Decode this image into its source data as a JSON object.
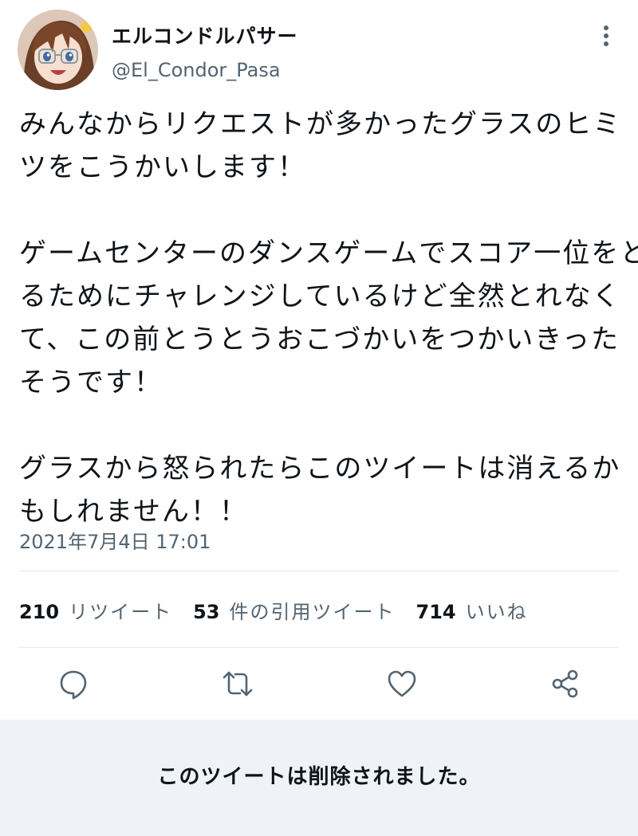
{
  "tweet": {
    "author": {
      "display_name": "エルコンドルパサー",
      "handle": "@El_Condor_Pasa",
      "avatar_icon": "character-avatar"
    },
    "more_icon": "more-vertical-icon",
    "body": [
      [
        "みんなからリクエストが多かったグラスのヒミ",
        "ツをこうかいします！"
      ],
      [
        "ゲームセンターのダンスゲームでスコア一位をと",
        "るためにチャレンジしているけど全然とれなく",
        "て、この前とうとうおこづかいをつかいきった",
        "そうです！"
      ],
      [
        "グラスから怒られたらこのツイートは消えるか",
        "もしれません！！"
      ]
    ],
    "timestamp": "2021年7月4日 17:01",
    "stats": {
      "retweets": {
        "count": "210",
        "label": "リツイート"
      },
      "quotes": {
        "count": "53",
        "label": "件の引用ツイート"
      },
      "likes": {
        "count": "714",
        "label": "いいね"
      }
    },
    "actions": [
      {
        "name": "reply",
        "icon": "reply-icon"
      },
      {
        "name": "retweet",
        "icon": "retweet-icon"
      },
      {
        "name": "like",
        "icon": "heart-icon"
      },
      {
        "name": "share",
        "icon": "share-icon"
      }
    ]
  },
  "notice": {
    "deleted_text": "このツイートは削除されました。"
  },
  "colors": {
    "text": "#0f1419",
    "secondary_text": "#536471",
    "divider": "#e1e8ed",
    "icon": "#536471",
    "notice_background": "#eff2f6"
  }
}
